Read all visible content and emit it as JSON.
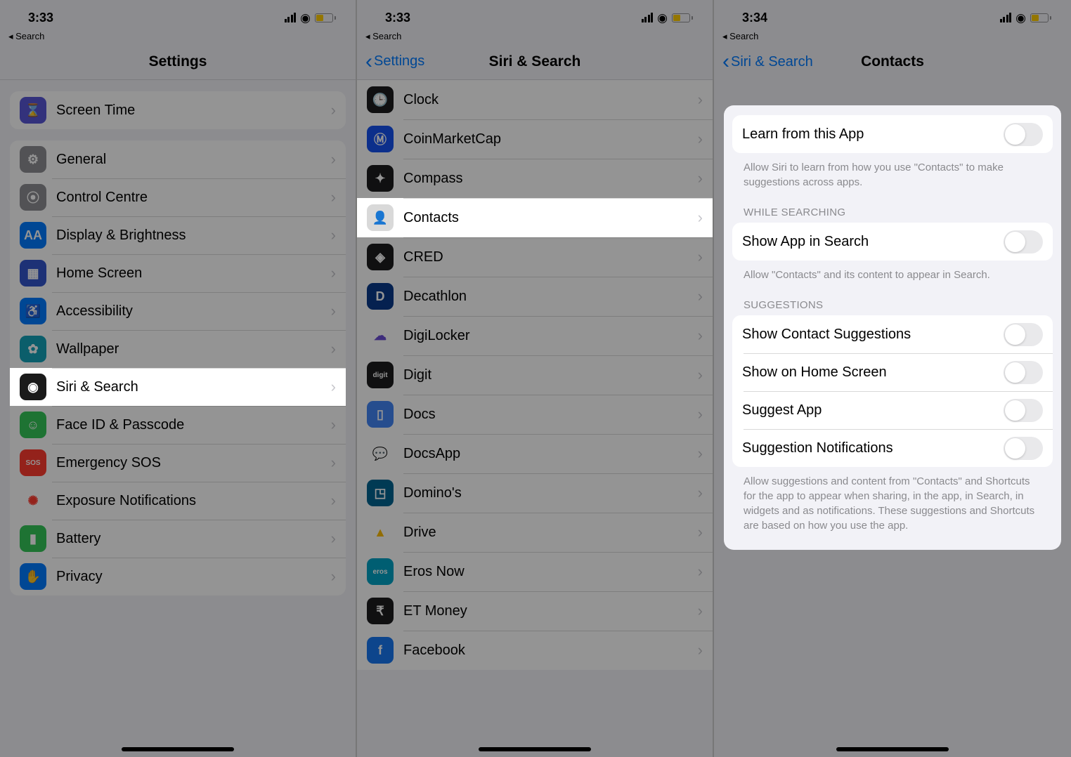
{
  "status": {
    "time1": "3:33",
    "time2": "3:33",
    "time3": "3:34",
    "back_app": "◂ Search"
  },
  "screen1": {
    "title": "Settings",
    "group0": [
      {
        "label": "Screen Time",
        "color": "#5856d6",
        "glyph": "⌛"
      }
    ],
    "group1": [
      {
        "label": "General",
        "color": "#8e8e93",
        "glyph": "⚙"
      },
      {
        "label": "Control Centre",
        "color": "#8e8e93",
        "glyph": "⦿"
      },
      {
        "label": "Display & Brightness",
        "color": "#007aff",
        "glyph": "AA"
      },
      {
        "label": "Home Screen",
        "color": "#3355cc",
        "glyph": "▦"
      },
      {
        "label": "Accessibility",
        "color": "#007aff",
        "glyph": "♿"
      },
      {
        "label": "Wallpaper",
        "color": "#14a2b8",
        "glyph": "✿"
      },
      {
        "label": "Siri & Search",
        "color": "#1a1a1a",
        "glyph": "◉",
        "highlight": true
      },
      {
        "label": "Face ID & Passcode",
        "color": "#34c759",
        "glyph": "☺"
      },
      {
        "label": "Emergency SOS",
        "color": "#ff3b30",
        "glyph": "SOS"
      },
      {
        "label": "Exposure Notifications",
        "color": "#fff",
        "glyph": "✺",
        "fg": "#ff3b30"
      },
      {
        "label": "Battery",
        "color": "#34c759",
        "glyph": "▮"
      },
      {
        "label": "Privacy",
        "color": "#007aff",
        "glyph": "✋"
      }
    ]
  },
  "screen2": {
    "back": "Settings",
    "title": "Siri & Search",
    "apps": [
      {
        "label": "Clock",
        "color": "#1c1c1e",
        "glyph": "🕒"
      },
      {
        "label": "CoinMarketCap",
        "color": "#1652f0",
        "glyph": "Ⓜ"
      },
      {
        "label": "Compass",
        "color": "#1c1c1e",
        "glyph": "✦"
      },
      {
        "label": "Contacts",
        "color": "#d9d9d9",
        "glyph": "👤",
        "highlight": true
      },
      {
        "label": "CRED",
        "color": "#1c1c1e",
        "glyph": "◈"
      },
      {
        "label": "Decathlon",
        "color": "#0a3a8a",
        "glyph": "D"
      },
      {
        "label": "DigiLocker",
        "color": "#fff",
        "glyph": "☁",
        "fg": "#6a4dd4"
      },
      {
        "label": "Digit",
        "color": "#1c1c1e",
        "glyph": "digit"
      },
      {
        "label": "Docs",
        "color": "#4285f4",
        "glyph": "▯"
      },
      {
        "label": "DocsApp",
        "color": "#fff",
        "glyph": "💬",
        "fg": "#2e7d32"
      },
      {
        "label": "Domino's",
        "color": "#006491",
        "glyph": "◳"
      },
      {
        "label": "Drive",
        "color": "#fff",
        "glyph": "▲",
        "fg": "#fbbc04"
      },
      {
        "label": "Eros Now",
        "color": "#00a3c4",
        "glyph": "eros"
      },
      {
        "label": "ET Money",
        "color": "#1c1c1e",
        "glyph": "₹"
      },
      {
        "label": "Facebook",
        "color": "#1877f2",
        "glyph": "f"
      }
    ]
  },
  "screen3": {
    "back": "Siri & Search",
    "title": "Contacts",
    "learn": {
      "label": "Learn from this App",
      "footer": "Allow Siri to learn from how you use \"Contacts\" to make suggestions across apps."
    },
    "searching": {
      "header": "While Searching",
      "row": "Show App in Search",
      "footer": "Allow \"Contacts\" and its content to appear in Search."
    },
    "suggestions": {
      "header": "Suggestions",
      "rows": [
        "Show Contact Suggestions",
        "Show on Home Screen",
        "Suggest App",
        "Suggestion Notifications"
      ],
      "footer": "Allow suggestions and content from \"Contacts\" and Shortcuts for the app to appear when sharing, in the app, in Search, in widgets and as notifications. These suggestions and Shortcuts are based on how you use the app."
    }
  }
}
